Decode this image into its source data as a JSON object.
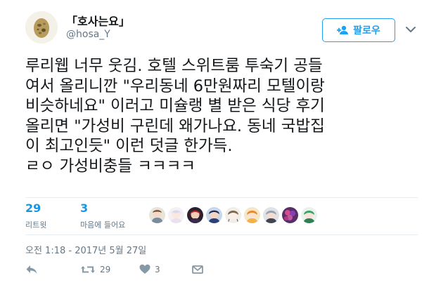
{
  "author": {
    "display_name": "「호사는요」",
    "handle": "@hosa_Y"
  },
  "follow_button": {
    "label": "팔로우"
  },
  "tweet": {
    "text": "루리웹 너무 웃김. 호텔 스위트룸 투숙기 공들\n여서 올리니깐 \"우리동네 6만원짜리 모텔이랑\n비슷하네요\" 이러고 미슐랭 별 받은 식당 후기\n올리면 \"가성비 구린데 왜가나요. 동네 국밥집\n이 최고인듯\" 이런 덧글 한가득.\nㄹㅇ 가성비충들 ㅋㅋㅋㅋ"
  },
  "stats": {
    "retweets": {
      "count": "29",
      "label": "리트윗"
    },
    "likes": {
      "count": "3",
      "label": "마음에 들어요"
    }
  },
  "timestamp": "오전 1:18 - 2017년 5월 27일",
  "actions": {
    "reply": {
      "icon": "reply-icon"
    },
    "retweet": {
      "icon": "retweet-icon",
      "count": "29"
    },
    "like": {
      "icon": "heart-icon",
      "count": "3"
    },
    "dm": {
      "icon": "direct-message-icon"
    }
  },
  "colors": {
    "accent": "#1da1f2",
    "link_count": "#1b95e0",
    "secondary_text": "#657786",
    "divider": "#e6ecf0"
  }
}
